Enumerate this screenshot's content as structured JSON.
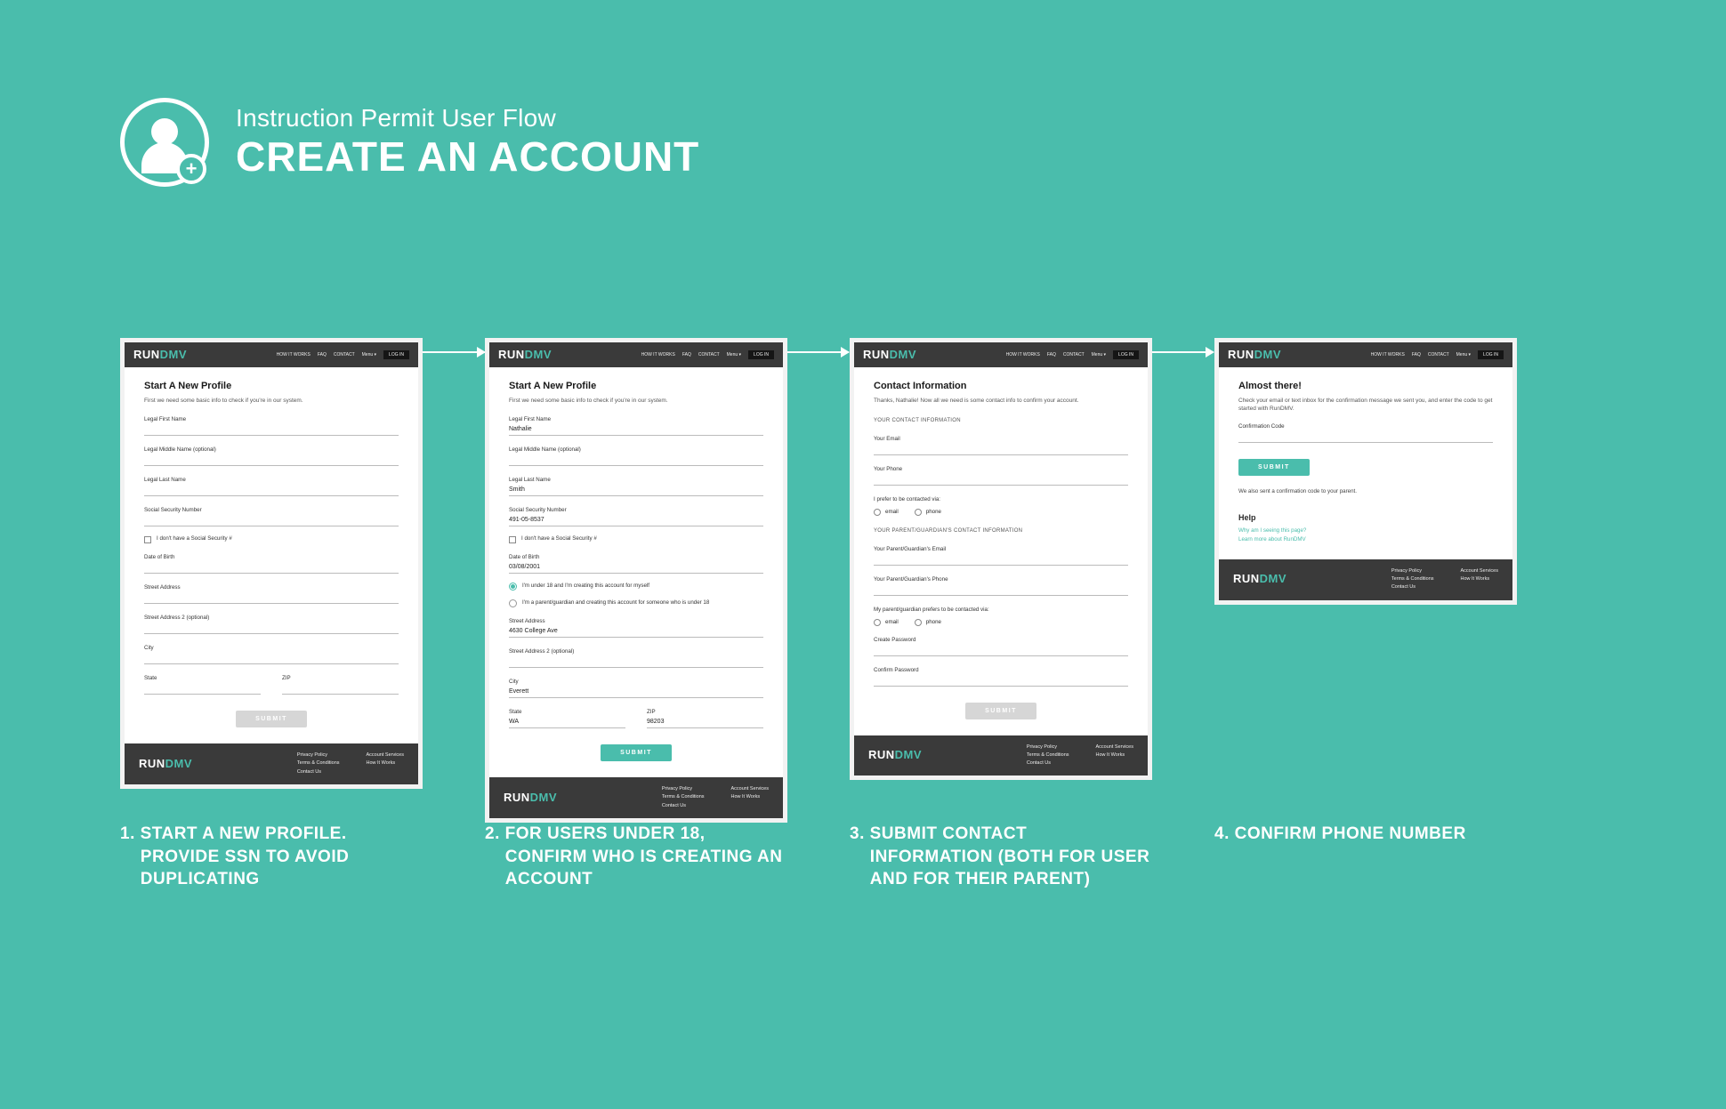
{
  "colors": {
    "accent": "#4ABDAC",
    "dark": "#3a3a3a"
  },
  "hero": {
    "subtitle": "Instruction Permit User Flow",
    "title": "CREATE AN ACCOUNT"
  },
  "brand": {
    "run": "RUN",
    "dmv": "DMV"
  },
  "nav": {
    "how": "HOW IT WORKS",
    "faq": "FAQ",
    "contact": "CONTACT",
    "menu": "Menu ▾",
    "login": "LOG IN"
  },
  "footer": {
    "col1": {
      "a": "Privacy Policy",
      "b": "Terms & Conditions",
      "c": "Contact Us"
    },
    "col2": {
      "a": "Account Services",
      "b": "How It Works"
    }
  },
  "step1": {
    "title": "Start A New Profile",
    "lead": "First we need some basic info to check if you're in our system.",
    "first": "Legal First Name",
    "middle": "Legal Middle Name (optional)",
    "last": "Legal Last Name",
    "ssn": "Social Security Number",
    "nossn": "I don't have a Social Security #",
    "dob": "Date of Birth",
    "street": "Street Address",
    "street2": "Street Address 2 (optional)",
    "city": "City",
    "state": "State",
    "zip": "ZIP",
    "submit": "SUBMIT"
  },
  "step2": {
    "title": "Start A New Profile",
    "lead": "First we need some basic info to check if you're in our system.",
    "firstVal": "Nathalie",
    "lastVal": "Smith",
    "ssnVal": "491-05-8537",
    "dobVal": "03/08/2001",
    "radioSelf": "I'm under 18 and I'm creating this account for myself",
    "radioParent": "I'm a parent/guardian and creating this account for someone who is under 18",
    "streetVal": "4630 College Ave",
    "cityVal": "Everett",
    "stateVal": "WA",
    "zipVal": "98203",
    "submit": "SUBMIT"
  },
  "step3": {
    "title": "Contact Information",
    "lead": "Thanks, Nathalie! Now all we need is some contact info to confirm your account.",
    "yourSection": "YOUR CONTACT INFORMATION",
    "yourEmail": "Your Email",
    "yourPhone": "Your Phone",
    "prefer": "I prefer to be contacted via:",
    "email": "email",
    "phone": "phone",
    "parentSection": "YOUR PARENT/GUARDIAN'S CONTACT INFORMATION",
    "parentEmail": "Your Parent/Guardian's Email",
    "parentPhone": "Your Parent/Guardian's Phone",
    "parentPrefer": "My parent/guardian prefers to be contacted via:",
    "createPw": "Create Password",
    "confirmPw": "Confirm Password",
    "submit": "SUBMIT"
  },
  "step4": {
    "title": "Almost there!",
    "lead": "Check your email or text inbox for the confirmation message we sent you, and enter the code to get started with RunDMV.",
    "code": "Confirmation Code",
    "submit": "SUBMIT",
    "note": "We also sent a confirmation code to your parent.",
    "helpTitle": "Help",
    "help1": "Why am I seeing this page?",
    "help2": "Learn more about RunDMV"
  },
  "captions": {
    "c1a": "1. START A NEW PROFILE.",
    "c1b": "PROVIDE SSN TO AVOID DUPLICATING",
    "c2a": "2. FOR USERS UNDER 18,",
    "c2b": "CONFIRM WHO IS CREATING AN ACCOUNT",
    "c3a": "3. SUBMIT CONTACT",
    "c3b": "INFORMATION  (BOTH FOR USER AND FOR THEIR PARENT)",
    "c4a": "4. CONFIRM PHONE NUMBER"
  }
}
